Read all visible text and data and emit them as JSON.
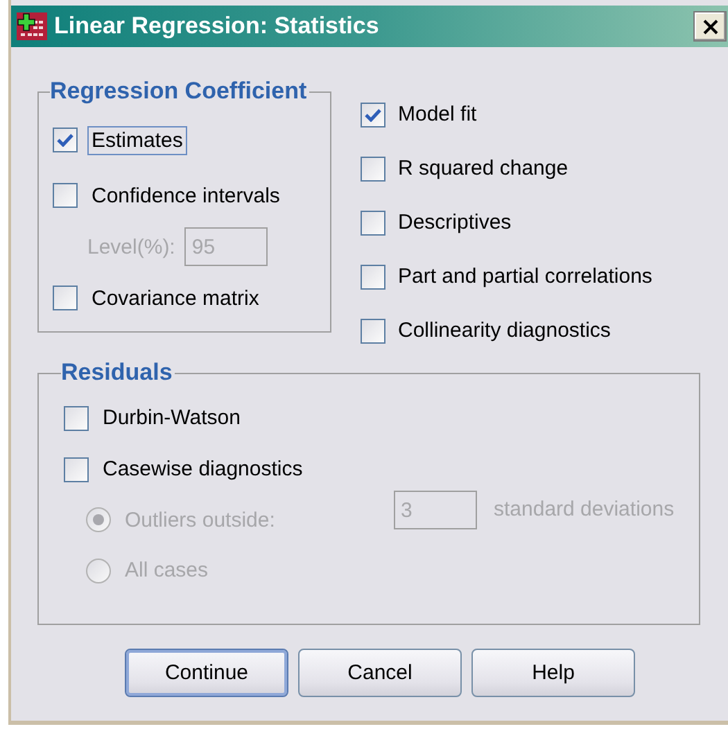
{
  "window": {
    "title": "Linear Regression: Statistics"
  },
  "regression_coefficient": {
    "title": "Regression Coefficient",
    "items": [
      {
        "kind": "checkbox",
        "label": "Estimates",
        "checked": true,
        "focused": true,
        "disabled": false
      },
      {
        "kind": "checkbox",
        "label": "Confidence intervals",
        "checked": false,
        "focused": false,
        "disabled": false
      },
      {
        "kind": "field",
        "label": "Level(%):",
        "value": "95",
        "disabled": true
      },
      {
        "kind": "checkbox",
        "label": "Covariance matrix",
        "checked": false,
        "focused": false,
        "disabled": false
      }
    ]
  },
  "options": [
    {
      "label": "Model fit",
      "checked": true
    },
    {
      "label": "R squared change",
      "checked": false
    },
    {
      "label": "Descriptives",
      "checked": false
    },
    {
      "label": "Part and partial correlations",
      "checked": false
    },
    {
      "label": "Collinearity diagnostics",
      "checked": false
    }
  ],
  "residuals": {
    "title": "Residuals",
    "items": [
      {
        "kind": "checkbox",
        "label": "Durbin-Watson",
        "checked": false,
        "disabled": false
      },
      {
        "kind": "checkbox",
        "label": "Casewise diagnostics",
        "checked": false,
        "disabled": false
      },
      {
        "kind": "radio",
        "label": "Outliers outside:",
        "selected": true,
        "disabled": true,
        "value": "3",
        "suffix": "standard deviations"
      },
      {
        "kind": "radio",
        "label": "All cases",
        "selected": false,
        "disabled": true
      }
    ]
  },
  "buttons": [
    {
      "label": "Continue",
      "default": true
    },
    {
      "label": "Cancel",
      "default": false
    },
    {
      "label": "Help",
      "default": false
    }
  ]
}
